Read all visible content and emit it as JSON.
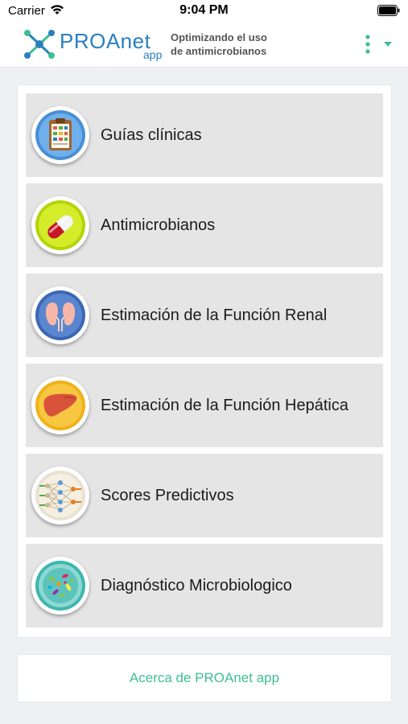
{
  "status_bar": {
    "carrier": "Carrier",
    "time": "9:04 PM",
    "wifi_icon": "wifi-icon",
    "battery_icon": "battery-icon"
  },
  "header": {
    "logo_text": "PROAnet",
    "logo_sub": "app",
    "tagline_line1": "Optimizando el uso",
    "tagline_line2": "de antimicrobianos",
    "menu_icon": "vertical-dots-icon",
    "caret_icon": "caret-down-icon",
    "brand_blue": "#2a7fc0",
    "accent_green": "#3dbf93"
  },
  "menu": {
    "items": [
      {
        "label": "Guías clínicas",
        "icon": "clipboard-icon"
      },
      {
        "label": "Antimicrobianos",
        "icon": "pill-icon"
      },
      {
        "label": "Estimación de la Función Renal",
        "icon": "kidneys-icon"
      },
      {
        "label": "Estimación de la Función Hepática",
        "icon": "liver-icon"
      },
      {
        "label": "Scores Predictivos",
        "icon": "neural-network-icon"
      },
      {
        "label": "Diagnóstico Microbiologico",
        "icon": "petri-dish-icon"
      }
    ]
  },
  "footer": {
    "about_label": "Acerca de PROAnet app"
  }
}
